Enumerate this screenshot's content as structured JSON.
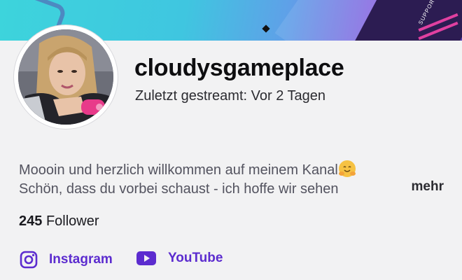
{
  "profile": {
    "username": "cloudysgameplace",
    "last_stream": "Zuletzt gestreamt: Vor 2 Tagen",
    "banner_tag": "SUPPORT",
    "description_line1": "Moooin und herzlich willkommen auf meinem Kanal",
    "description_line2": "Schön, dass du vorbei schaust - ich hoffe wir sehen",
    "more_label": "mehr",
    "follower_count": "245",
    "follower_label": "Follower"
  },
  "links": {
    "instagram_label": "Instagram",
    "youtube_label": "YouTube"
  },
  "icons": {
    "emoji": "hugging-face-emoji",
    "instagram": "instagram-icon",
    "youtube": "youtube-icon"
  },
  "colors": {
    "link": "#5c2ccf",
    "text_primary": "#0e0e10",
    "text_secondary": "#53535f",
    "background": "#f2f2f3"
  }
}
